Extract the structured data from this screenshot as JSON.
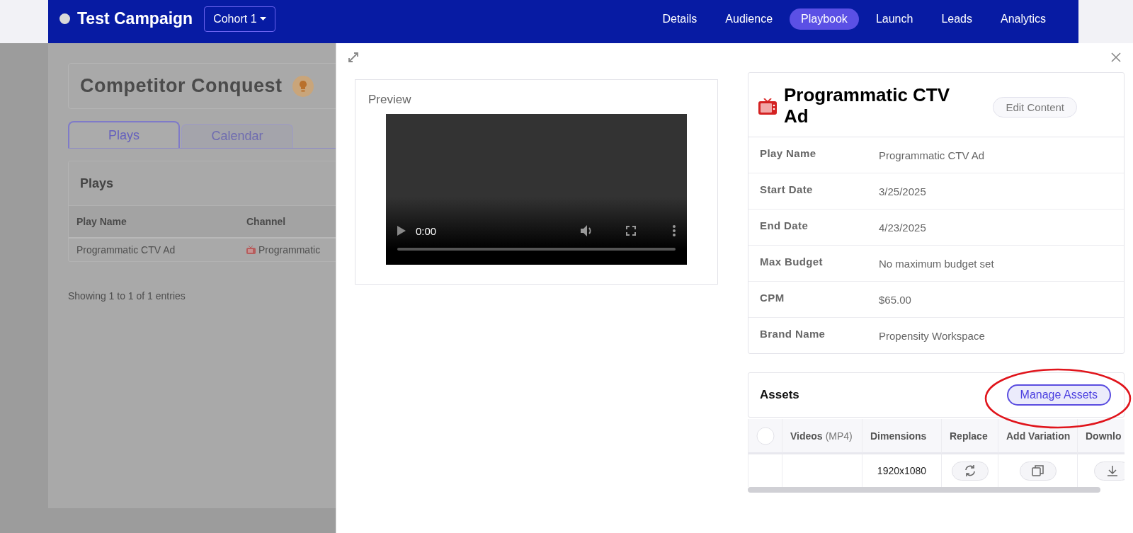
{
  "header": {
    "title": "Test Campaign",
    "cohort": "Cohort 1",
    "nav": [
      {
        "label": "Details",
        "selected": false
      },
      {
        "label": "Audience",
        "selected": false
      },
      {
        "label": "Playbook",
        "selected": true
      },
      {
        "label": "Launch",
        "selected": false
      },
      {
        "label": "Leads",
        "selected": false
      },
      {
        "label": "Analytics",
        "selected": false
      }
    ]
  },
  "background": {
    "title": "Competitor Conquest",
    "tabs": [
      {
        "label": "Plays",
        "selected": true
      },
      {
        "label": "Calendar",
        "selected": false
      }
    ],
    "plays": {
      "title": "Plays",
      "columns": [
        "Play Name",
        "Channel"
      ],
      "rows": [
        [
          "Programmatic CTV Ad",
          "Programmatic"
        ]
      ]
    },
    "footer": "Showing 1 to 1 of 1 entries"
  },
  "drawer": {
    "preview": {
      "title": "Preview",
      "time": "0:00"
    },
    "play": {
      "title": "Programmatic CTV Ad",
      "edit_button": "Edit Content",
      "fields": [
        {
          "label": "Play Name",
          "value": "Programmatic CTV Ad"
        },
        {
          "label": "Start Date",
          "value": "3/25/2025"
        },
        {
          "label": "End Date",
          "value": "4/23/2025"
        },
        {
          "label": "Max Budget",
          "value": "No maximum budget set"
        },
        {
          "label": "CPM",
          "value": "$65.00"
        },
        {
          "label": "Brand Name",
          "value": "Propensity Workspace"
        }
      ]
    },
    "assets": {
      "title": "Assets",
      "manage_button": "Manage Assets",
      "select_all_checked": false,
      "columns": [
        {
          "label": "Videos",
          "note": "(MP4)"
        },
        {
          "label": "Dimensions"
        },
        {
          "label": "Replace"
        },
        {
          "label": "Add Variation"
        },
        {
          "label": "Downlo"
        }
      ],
      "rows": [
        {
          "dimensions": "1920x1080"
        }
      ]
    }
  }
}
